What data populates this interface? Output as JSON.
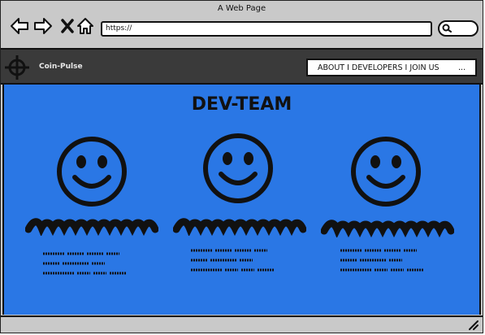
{
  "window": {
    "title": "A Web Page"
  },
  "toolbar": {
    "url": "https://",
    "buttons": [
      "back-icon",
      "forward-icon",
      "close-icon",
      "home-icon"
    ],
    "search_icon": "search-icon"
  },
  "header": {
    "brand": "Coin-Pulse",
    "logo_icon": "crosshair-icon",
    "menu_label": "ABOUT I DEVELOPERS I JOIN US",
    "menu_more": "..."
  },
  "main": {
    "title": "DEV-TEAM",
    "members": [
      {
        "avatar_icon": "smiley-icon"
      },
      {
        "avatar_icon": "smiley-icon"
      },
      {
        "avatar_icon": "smiley-icon"
      }
    ]
  },
  "colors": {
    "content_bg": "#2a77e5",
    "header_bg": "#3a3a3a",
    "chrome": "#c9c9c9"
  }
}
